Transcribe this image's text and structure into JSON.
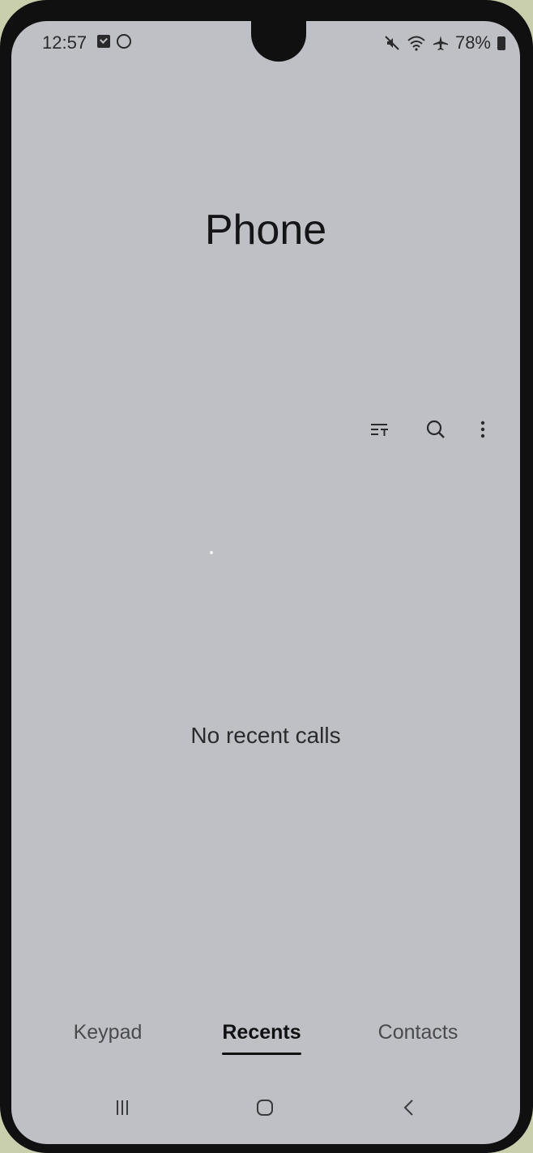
{
  "status_bar": {
    "time": "12:57",
    "battery": "78%",
    "left_icons": [
      "checkbox-notification-icon",
      "app-notification-icon"
    ],
    "right_icons": [
      "mute-icon",
      "wifi-icon",
      "airplane-icon",
      "battery-icon"
    ]
  },
  "header": {
    "title": "Phone"
  },
  "toolbar": {
    "icons": [
      "filter-icon",
      "search-icon",
      "more-options-icon"
    ]
  },
  "main": {
    "empty_message": "No recent calls"
  },
  "tabs": [
    {
      "label": "Keypad",
      "active": false
    },
    {
      "label": "Recents",
      "active": true
    },
    {
      "label": "Contacts",
      "active": false
    }
  ],
  "navbar": {
    "icons": [
      "recents-icon",
      "home-icon",
      "back-icon"
    ]
  },
  "colors": {
    "background": "#bfc0c5",
    "text_primary": "#151517",
    "text_secondary": "#4a4a4e"
  }
}
